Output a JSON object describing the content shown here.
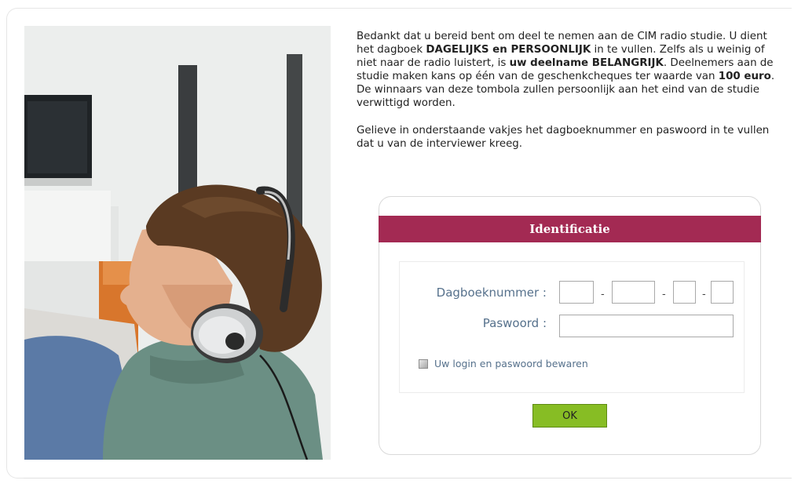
{
  "intro": {
    "p1_a": "Bedankt dat u bereid bent om deel te nemen aan de CIM radio studie.  U dient het dagboek ",
    "p1_b1": "DAGELIJKS en PERSOONLIJK",
    "p1_c": " in te vullen.  Zelfs als u weinig of niet naar de radio luistert, is ",
    "p1_b2": "uw deelname BELANGRIJK",
    "p1_d": ". Deelnemers aan de studie maken kans op één van de geschenkcheques ter waarde van ",
    "p1_b3": "100 euro",
    "p1_e": ".  De winnaars van deze tombola zullen persoonlijk aan het eind van de studie verwittigd worden.",
    "p2": "Gelieve in onderstaande vakjes het dagboeknummer en paswoord in te vullen dat u van de interviewer kreeg."
  },
  "form": {
    "title": "Identificatie",
    "dagboek_label": "Dagboeknummer :",
    "dagboek_parts": [
      "",
      "",
      "",
      ""
    ],
    "separator": "-",
    "paswoord_label": "Paswoord :",
    "paswoord_value": "",
    "remember_label": "Uw login en paswoord bewaren",
    "remember_checked": false,
    "ok_label": "OK"
  },
  "colors": {
    "header_bg": "#a32a53",
    "label_text": "#56718c",
    "ok_button": "#87bd24"
  },
  "photo": {
    "subject": "man-with-headphones"
  }
}
